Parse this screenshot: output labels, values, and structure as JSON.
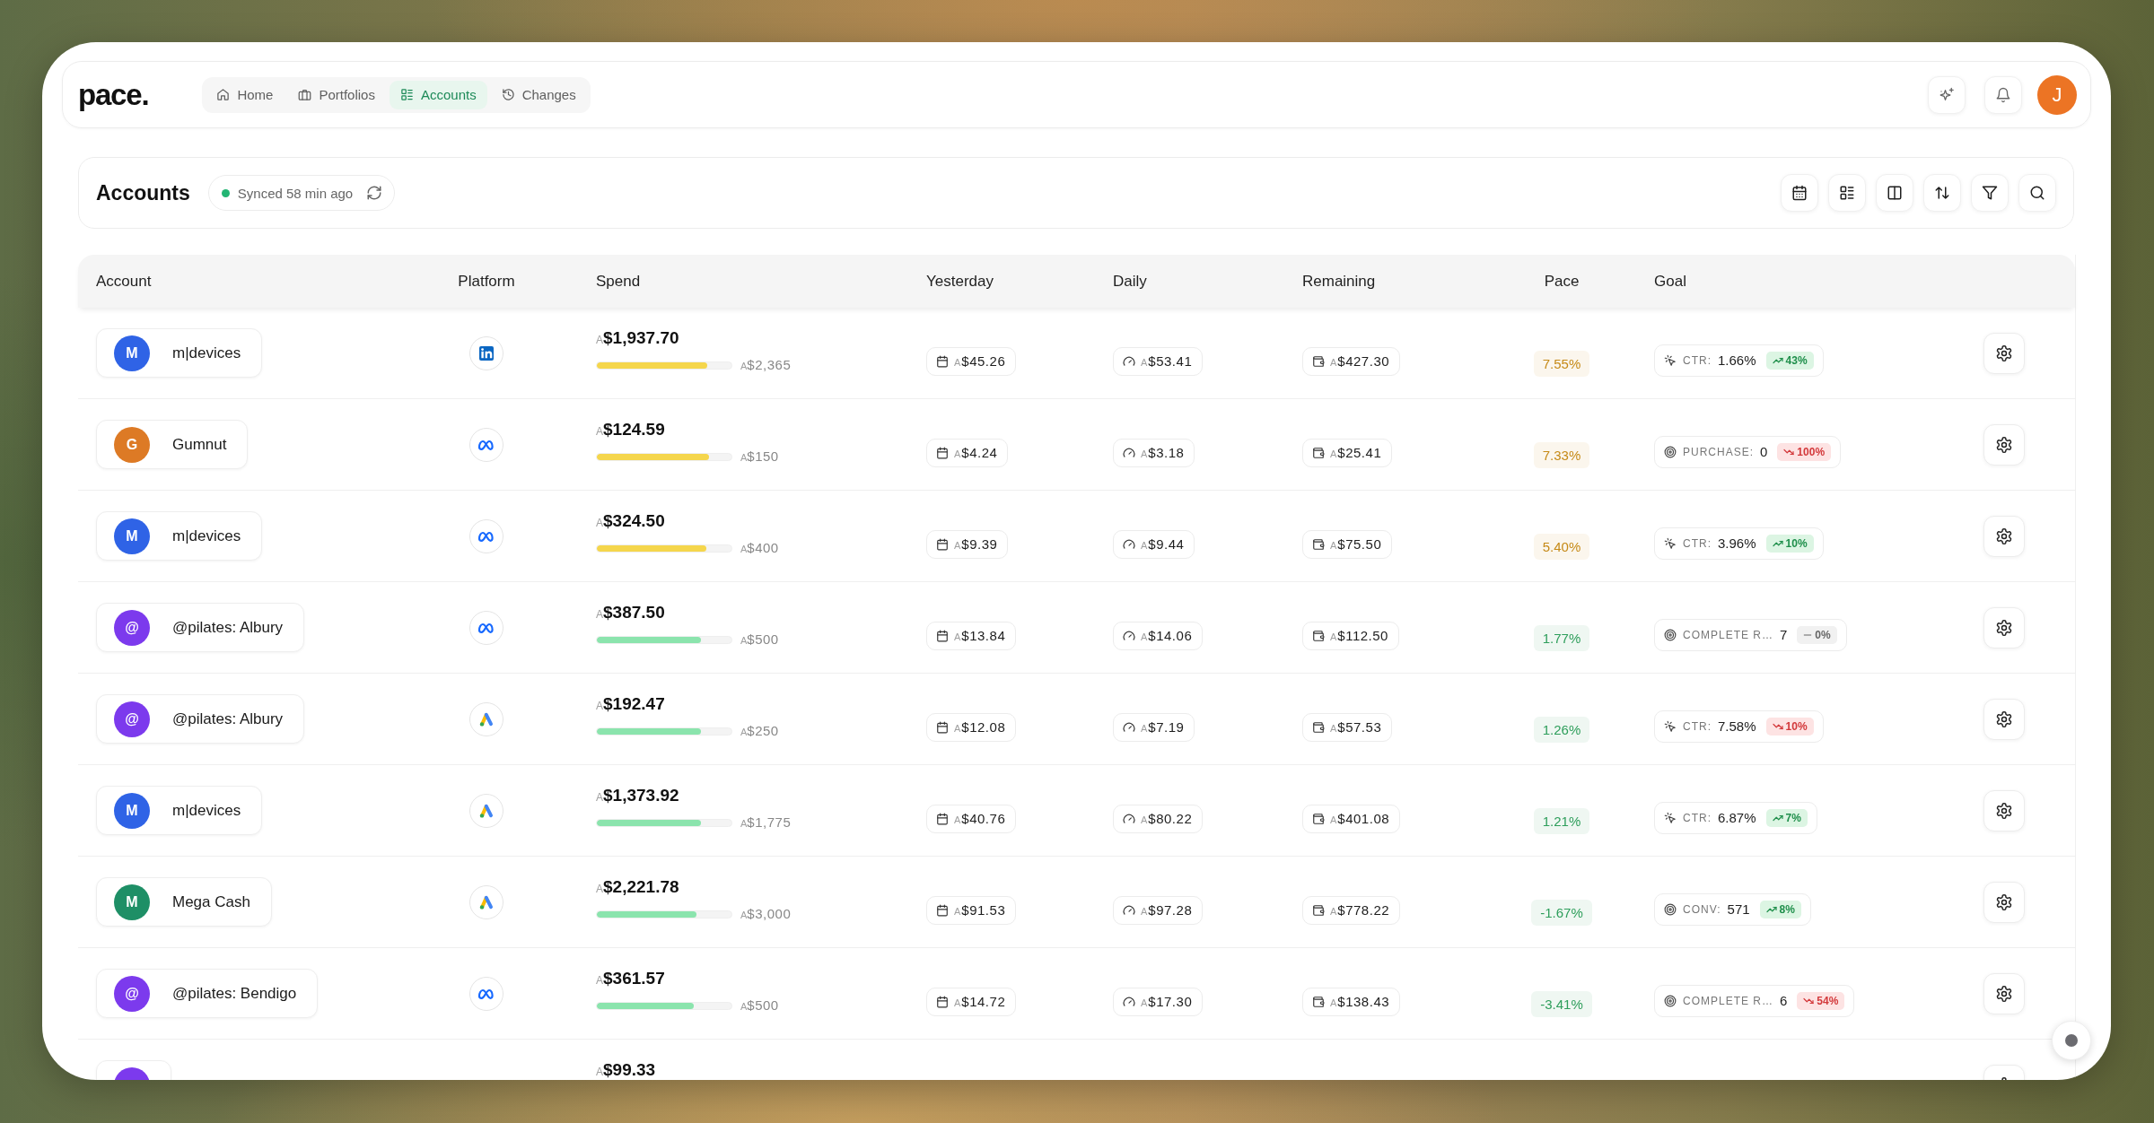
{
  "nav": {
    "logo": "pace.",
    "tabs": [
      {
        "kind": "home",
        "label": "Home",
        "selected": false
      },
      {
        "kind": "portfolios",
        "label": "Portfolios",
        "selected": false
      },
      {
        "kind": "accounts",
        "label": "Accounts",
        "selected": true
      },
      {
        "kind": "changes",
        "label": "Changes",
        "selected": false
      }
    ],
    "user_initial": "J"
  },
  "page": {
    "title": "Accounts",
    "sync": {
      "text": "Synced 58 min ago",
      "synced": true
    }
  },
  "table": {
    "columns": [
      "Account",
      "Platform",
      "Spend",
      "Yesterday",
      "Daily",
      "Remaining",
      "Pace",
      "Goal"
    ],
    "rows": [
      {
        "account": {
          "initial": "M",
          "color": "#2f63e6",
          "name": "m|devices"
        },
        "platform": {
          "kind": "linkedin"
        },
        "spend": {
          "currency": "A",
          "amount": "$1,937.70"
        },
        "spend_bar": {
          "level": 0.82,
          "color": "#f5d64c"
        },
        "budget": {
          "currency": "A",
          "amount": "$2,365"
        },
        "yesterday": {
          "currency": "A",
          "amount": "$45.26"
        },
        "daily": {
          "currency": "A",
          "amount": "$53.41"
        },
        "remaining": {
          "currency": "A",
          "amount": "$427.30"
        },
        "pace": {
          "text": "7.55%",
          "color": "#c68a17"
        },
        "goal": {
          "kind": "click",
          "label": "CTR:",
          "value": "1.66%",
          "trend": {
            "kind": "up",
            "text": "43%"
          }
        }
      },
      {
        "account": {
          "initial": "G",
          "color": "#dd7a25",
          "name": "Gumnut"
        },
        "platform": {
          "kind": "meta"
        },
        "spend": {
          "currency": "A",
          "amount": "$124.59"
        },
        "spend_bar": {
          "level": 0.83,
          "color": "#f5d64c"
        },
        "budget": {
          "currency": "A",
          "amount": "$150"
        },
        "yesterday": {
          "currency": "A",
          "amount": "$4.24"
        },
        "daily": {
          "currency": "A",
          "amount": "$3.18"
        },
        "remaining": {
          "currency": "A",
          "amount": "$25.41"
        },
        "pace": {
          "text": "7.33%",
          "color": "#c68a17"
        },
        "goal": {
          "kind": "target",
          "label": "PURCHASE:",
          "value": "0",
          "trend": {
            "kind": "down",
            "text": "100%"
          }
        }
      },
      {
        "account": {
          "initial": "M",
          "color": "#2f63e6",
          "name": "m|devices"
        },
        "platform": {
          "kind": "meta"
        },
        "spend": {
          "currency": "A",
          "amount": "$324.50"
        },
        "spend_bar": {
          "level": 0.81,
          "color": "#f5d64c"
        },
        "budget": {
          "currency": "A",
          "amount": "$400"
        },
        "yesterday": {
          "currency": "A",
          "amount": "$9.39"
        },
        "daily": {
          "currency": "A",
          "amount": "$9.44"
        },
        "remaining": {
          "currency": "A",
          "amount": "$75.50"
        },
        "pace": {
          "text": "5.40%",
          "color": "#c68a17"
        },
        "goal": {
          "kind": "click",
          "label": "CTR:",
          "value": "3.96%",
          "trend": {
            "kind": "up",
            "text": "10%"
          }
        }
      },
      {
        "account": {
          "initial": "@",
          "color": "#7c3aed",
          "name": "@pilates: Albury"
        },
        "platform": {
          "kind": "meta"
        },
        "spend": {
          "currency": "A",
          "amount": "$387.50"
        },
        "spend_bar": {
          "level": 0.775,
          "color": "#8be4ad"
        },
        "budget": {
          "currency": "A",
          "amount": "$500"
        },
        "yesterday": {
          "currency": "A",
          "amount": "$13.84"
        },
        "daily": {
          "currency": "A",
          "amount": "$14.06"
        },
        "remaining": {
          "currency": "A",
          "amount": "$112.50"
        },
        "pace": {
          "text": "1.77%",
          "color": "#2e9e5b"
        },
        "goal": {
          "kind": "target",
          "label": "COMPLETE R…",
          "value": "7",
          "trend": {
            "kind": "flat",
            "text": "0%"
          }
        }
      },
      {
        "account": {
          "initial": "@",
          "color": "#7c3aed",
          "name": "@pilates: Albury"
        },
        "platform": {
          "kind": "google_ads"
        },
        "spend": {
          "currency": "A",
          "amount": "$192.47"
        },
        "spend_bar": {
          "level": 0.77,
          "color": "#8be4ad"
        },
        "budget": {
          "currency": "A",
          "amount": "$250"
        },
        "yesterday": {
          "currency": "A",
          "amount": "$12.08"
        },
        "daily": {
          "currency": "A",
          "amount": "$7.19"
        },
        "remaining": {
          "currency": "A",
          "amount": "$57.53"
        },
        "pace": {
          "text": "1.26%",
          "color": "#2e9e5b"
        },
        "goal": {
          "kind": "click",
          "label": "CTR:",
          "value": "7.58%",
          "trend": {
            "kind": "down",
            "text": "10%"
          }
        }
      },
      {
        "account": {
          "initial": "M",
          "color": "#2f63e6",
          "name": "m|devices"
        },
        "platform": {
          "kind": "google_ads"
        },
        "spend": {
          "currency": "A",
          "amount": "$1,373.92"
        },
        "spend_bar": {
          "level": 0.774,
          "color": "#8be4ad"
        },
        "budget": {
          "currency": "A",
          "amount": "$1,775"
        },
        "yesterday": {
          "currency": "A",
          "amount": "$40.76"
        },
        "daily": {
          "currency": "A",
          "amount": "$80.22"
        },
        "remaining": {
          "currency": "A",
          "amount": "$401.08"
        },
        "pace": {
          "text": "1.21%",
          "color": "#2e9e5b"
        },
        "goal": {
          "kind": "click",
          "label": "CTR:",
          "value": "6.87%",
          "trend": {
            "kind": "up",
            "text": "7%"
          }
        }
      },
      {
        "account": {
          "initial": "M",
          "color": "#1e8f66",
          "name": "Mega Cash"
        },
        "platform": {
          "kind": "google_ads"
        },
        "spend": {
          "currency": "A",
          "amount": "$2,221.78"
        },
        "spend_bar": {
          "level": 0.74,
          "color": "#8be4ad"
        },
        "budget": {
          "currency": "A",
          "amount": "$3,000"
        },
        "yesterday": {
          "currency": "A",
          "amount": "$91.53"
        },
        "daily": {
          "currency": "A",
          "amount": "$97.28"
        },
        "remaining": {
          "currency": "A",
          "amount": "$778.22"
        },
        "pace": {
          "text": "-1.67%",
          "color": "#2e9e5b"
        },
        "goal": {
          "kind": "target",
          "label": "CONV:",
          "value": "571",
          "trend": {
            "kind": "up",
            "text": "8%"
          }
        }
      },
      {
        "account": {
          "initial": "@",
          "color": "#7c3aed",
          "name": "@pilates: Bendigo"
        },
        "platform": {
          "kind": "meta"
        },
        "spend": {
          "currency": "A",
          "amount": "$361.57"
        },
        "spend_bar": {
          "level": 0.72,
          "color": "#8be4ad"
        },
        "budget": {
          "currency": "A",
          "amount": "$500"
        },
        "yesterday": {
          "currency": "A",
          "amount": "$14.72"
        },
        "daily": {
          "currency": "A",
          "amount": "$17.30"
        },
        "remaining": {
          "currency": "A",
          "amount": "$138.43"
        },
        "pace": {
          "text": "-3.41%",
          "color": "#2e9e5b"
        },
        "goal": {
          "kind": "target",
          "label": "COMPLETE R…",
          "value": "6",
          "trend": {
            "kind": "down",
            "text": "54%"
          }
        }
      },
      {
        "account": {
          "color": "#7c3aed"
        },
        "spend": {
          "currency": "A",
          "amount": "$99.33"
        }
      }
    ]
  }
}
